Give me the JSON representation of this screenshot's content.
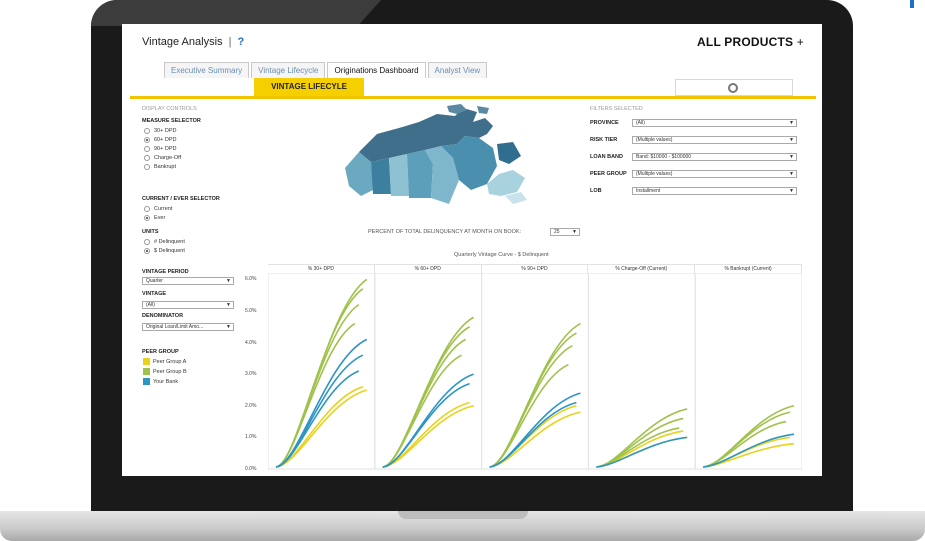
{
  "header": {
    "title": "Vintage Analysis",
    "separator": "|",
    "help": "?",
    "products": "ALL PRODUCTS",
    "products_plus": "+"
  },
  "tabs": [
    {
      "label": "Executive Summary"
    },
    {
      "label": "Vintage Lifecycle"
    },
    {
      "label": "Originations Dashboard"
    },
    {
      "label": "Analyst View"
    }
  ],
  "banner": {
    "label": "VINTAGE LIFECYLE"
  },
  "display_controls": {
    "title": "DISPLAY CONTROLS",
    "measure_label": "MEASURE SELECTOR",
    "measures": [
      "30+ DPD",
      "60+ DPD",
      "90+ DPD",
      "Charge-Off",
      "Bankrupt"
    ],
    "measure_selected": 1,
    "current_ever_label": "CURRENT / EVER SELECTOR",
    "current_ever": [
      "Current",
      "Ever"
    ],
    "current_ever_selected": 1,
    "units_label": "UNITS",
    "units": [
      "# Delinquent",
      "$ Delinquent"
    ],
    "units_selected": 1,
    "vintage_period_label": "VINTAGE PERIOD",
    "vintage_period_value": "Quarter",
    "vintage_label": "VINTAGE",
    "vintage_value": "(All)",
    "denominator_label": "DENOMINATOR",
    "denominator_value": "Original Loan/Limit Amo...",
    "peer_group_label": "PEER GROUP",
    "peer_groups": [
      {
        "name": "Peer Group A",
        "color": "#e8d21a"
      },
      {
        "name": "Peer Group B",
        "color": "#9fc24a"
      },
      {
        "name": "Your Bank",
        "color": "#2b95c4"
      }
    ]
  },
  "filters": {
    "title": "FILTERS SELECTED",
    "rows": [
      {
        "label": "PROVINCE",
        "value": "(All)"
      },
      {
        "label": "RISK TIER",
        "value": "(Multiple values)"
      },
      {
        "label": "LOAN BAND",
        "value": "Band: $10000 - $100000"
      },
      {
        "label": "PEER GROUP",
        "value": "(Multiple values)"
      },
      {
        "label": "LOB",
        "value": "Installment"
      }
    ]
  },
  "map_caption": "PERCENT OF TOTAL DELINQUENCY AT MONTH ON BOOK:",
  "month_on_book": "25",
  "chart_data": {
    "type": "line",
    "title": "Quarterly Vintage Curve - $ Delinquent",
    "panels": [
      "% 30+ DPD",
      "% 60+ DPD",
      "% 90+ DPD",
      "% Charge-Off (Current)",
      "% Bankrupt (Current)"
    ],
    "y_ticks": [
      "6.0%",
      "5.0%",
      "4.0%",
      "3.0%",
      "2.0%",
      "1.0%",
      "0.0%"
    ],
    "ylim": [
      0,
      6.2
    ],
    "series": [
      {
        "name": "Peer Group A",
        "color": "#e8d21a",
        "ends": [
          [
            2.5,
            2.6
          ],
          [
            2.0,
            2.1
          ],
          [
            1.8,
            2.0
          ],
          [
            1.0,
            1.2
          ],
          [
            0.8,
            1.0
          ]
        ]
      },
      {
        "name": "Peer Group B",
        "color": "#9fc24a",
        "ends": [
          [
            6.0,
            5.7,
            5.2,
            4.6
          ],
          [
            4.8,
            4.5,
            4.1,
            3.6
          ],
          [
            4.6,
            4.3,
            3.9,
            3.3
          ],
          [
            1.9,
            1.6,
            1.3
          ],
          [
            2.0,
            1.8,
            1.5
          ]
        ]
      },
      {
        "name": "Your Bank",
        "color": "#2b95c4",
        "ends": [
          [
            4.1,
            3.6,
            3.1
          ],
          [
            3.0,
            2.7
          ],
          [
            2.4,
            2.1
          ],
          [
            1.0
          ],
          [
            1.1
          ]
        ]
      }
    ]
  }
}
